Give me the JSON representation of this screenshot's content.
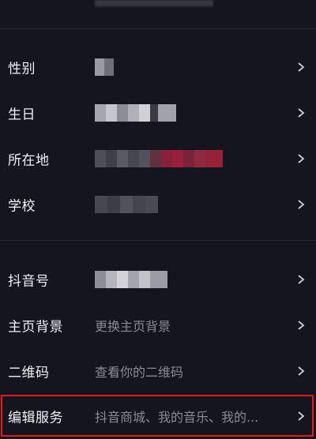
{
  "rows": [
    {
      "label": "性别",
      "value": ""
    },
    {
      "label": "生日",
      "value": ""
    },
    {
      "label": "所在地",
      "value": ""
    },
    {
      "label": "学校",
      "value": ""
    },
    {
      "label": "抖音号",
      "value": ""
    },
    {
      "label": "主页背景",
      "value": "更换主页背景"
    },
    {
      "label": "二维码",
      "value": "查看你的二维码"
    },
    {
      "label": "编辑服务",
      "value": "抖音商城、我的音乐、我的..."
    }
  ],
  "icons": {
    "chevron": "chevron-right-icon"
  },
  "colors": {
    "background": "#15151f",
    "label": "#f0f0f4",
    "value": "#8a8a97",
    "highlight_border": "#e21b1b"
  }
}
